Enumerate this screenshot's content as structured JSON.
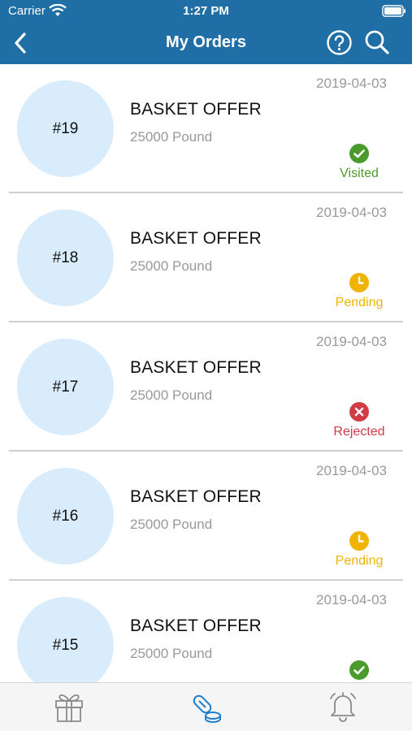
{
  "status_bar": {
    "carrier": "Carrier",
    "time": "1:27 PM"
  },
  "nav": {
    "title": "My Orders",
    "back_icon": "chevron-left-icon",
    "help_icon": "question-circle-icon",
    "search_icon": "search-icon"
  },
  "colors": {
    "header": "#1f6fa6",
    "circle": "#d9ecfb",
    "visited": "#4a9a2c",
    "pending": "#f0b400",
    "rejected": "#d23c45",
    "active_tab": "#1f7fd0"
  },
  "orders": [
    {
      "number": "#19",
      "title": "BASKET OFFER",
      "price": "25000 Pound",
      "date": "2019-04-03",
      "status": "Visited"
    },
    {
      "number": "#18",
      "title": "BASKET OFFER",
      "price": "25000 Pound",
      "date": "2019-04-03",
      "status": "Pending"
    },
    {
      "number": "#17",
      "title": "BASKET OFFER",
      "price": "25000 Pound",
      "date": "2019-04-03",
      "status": "Rejected"
    },
    {
      "number": "#16",
      "title": "BASKET OFFER",
      "price": "25000 Pound",
      "date": "2019-04-03",
      "status": "Pending"
    },
    {
      "number": "#15",
      "title": "BASKET OFFER",
      "price": "25000 Pound",
      "date": "2019-04-03",
      "status": ""
    }
  ],
  "tabs": [
    {
      "icon": "gift-icon",
      "active": false
    },
    {
      "icon": "pills-icon",
      "active": true
    },
    {
      "icon": "bell-icon",
      "active": false
    }
  ]
}
